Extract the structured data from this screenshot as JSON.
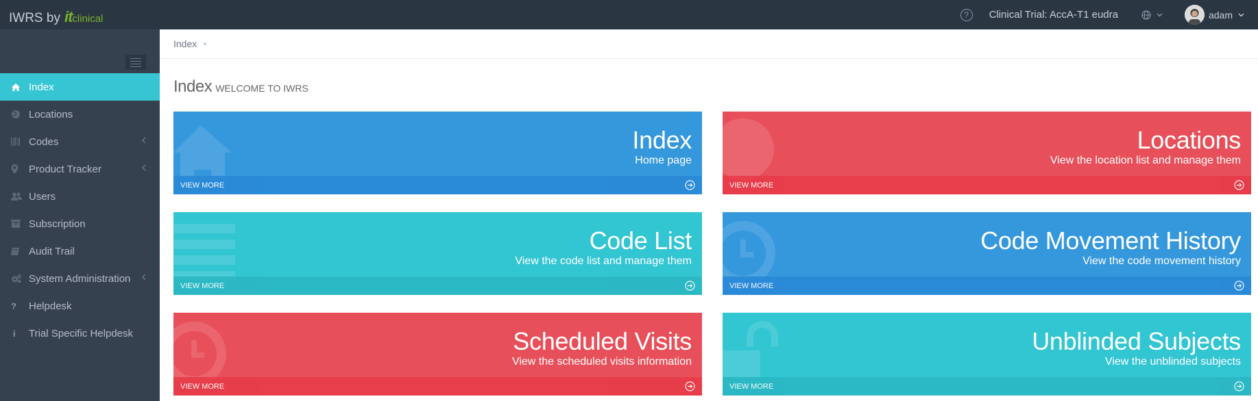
{
  "header": {
    "brand_prefix": "IWRS by",
    "brand_it": "it",
    "brand_clinical": "clinical",
    "trial": "Clinical Trial: AccA-T1 eudra",
    "user_name": "adam"
  },
  "sidebar": {
    "items": [
      {
        "label": "Index",
        "icon": "home-icon"
      },
      {
        "label": "Locations",
        "icon": "globe-icon"
      },
      {
        "label": "Codes",
        "icon": "barcode-icon"
      },
      {
        "label": "Product Tracker",
        "icon": "map-pin-icon"
      },
      {
        "label": "Users",
        "icon": "users-icon"
      },
      {
        "label": "Subscription",
        "icon": "archive-icon"
      },
      {
        "label": "Audit Trail",
        "icon": "book-icon"
      },
      {
        "label": "System Administration",
        "icon": "cogs-icon"
      },
      {
        "label": "Helpdesk",
        "icon": "question-icon"
      },
      {
        "label": "Trial Specific Helpdesk",
        "icon": "info-icon"
      }
    ]
  },
  "breadcrumb": {
    "label": "Index"
  },
  "page": {
    "title": "Index",
    "subtitle": "welcome to IWRS"
  },
  "tiles": [
    {
      "title": "Index",
      "desc": "Home page",
      "more": "View more",
      "color": "#3598dc"
    },
    {
      "title": "Locations",
      "desc": "View the location list and manage them",
      "more": "View more",
      "color": "#e7505a"
    },
    {
      "title": "Code List",
      "desc": "View the code list and manage them",
      "more": "View more",
      "color": "#32c5d2"
    },
    {
      "title": "Code Movement History",
      "desc": "View the code movement history",
      "more": "View more",
      "color": "#3598dc"
    },
    {
      "title": "Scheduled Visits",
      "desc": "View the scheduled visits information",
      "more": "View more",
      "color": "#e7505a"
    },
    {
      "title": "Unblinded Subjects",
      "desc": "View the unblinded subjects",
      "more": "View more",
      "color": "#32c5d2"
    }
  ]
}
